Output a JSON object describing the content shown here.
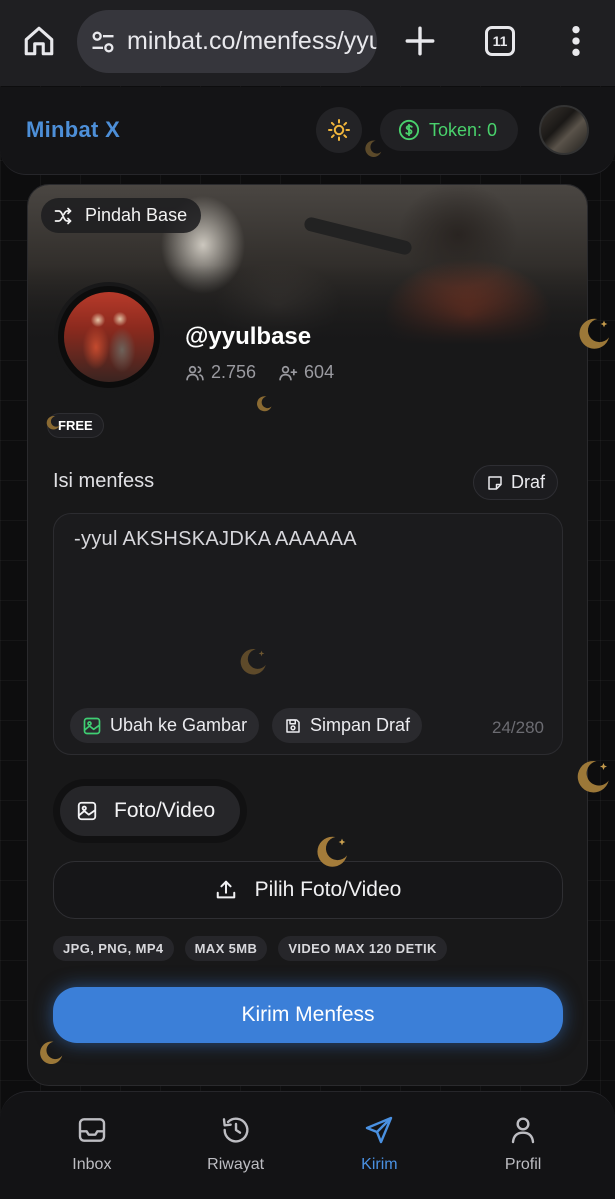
{
  "browser": {
    "url": "minbat.co/menfess/yyulbase",
    "tab_count": "11"
  },
  "header": {
    "brand": "Minbat X",
    "token_label": "Token: 0"
  },
  "card": {
    "switch_base_label": "Pindah Base",
    "handle": "@yyulbase",
    "followers": "2.756",
    "following": "604",
    "badge": "FREE",
    "section_label": "Isi menfess",
    "draft_label": "Draf",
    "message_text": "-yyul AKSHSKAJDKA AAAAAA",
    "convert_image_label": "Ubah ke Gambar",
    "save_draft_label": "Simpan Draf",
    "char_counter": "24/280",
    "media_tab_label": "Foto/Video",
    "pick_media_label": "Pilih Foto/Video",
    "formats": [
      "JPG, PNG, MP4",
      "MAX 5MB",
      "VIDEO MAX 120 DETIK"
    ],
    "send_label": "Kirim Menfess"
  },
  "nav": {
    "items": [
      {
        "label": "Inbox",
        "icon": "inbox-icon",
        "active": false
      },
      {
        "label": "Riwayat",
        "icon": "history-icon",
        "active": false
      },
      {
        "label": "Kirim",
        "icon": "send-icon",
        "active": true
      },
      {
        "label": "Profil",
        "icon": "user-icon",
        "active": false
      }
    ]
  },
  "colors": {
    "accent": "#3b7fd8",
    "token_green": "#49d26c",
    "brand_blue": "#4d8fd8",
    "moon_gold": "#a07a3a"
  }
}
